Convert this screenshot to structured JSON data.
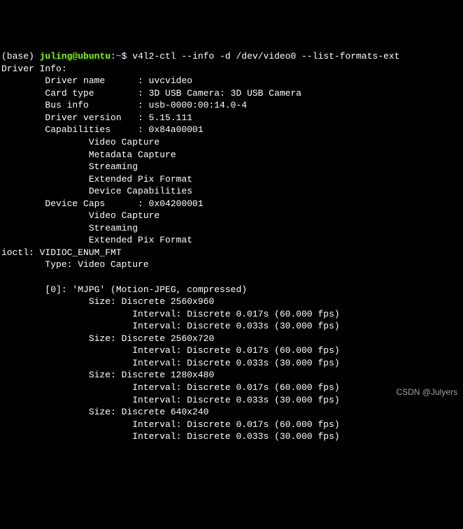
{
  "prompt": {
    "env": "(base) ",
    "user": "juling",
    "at": "@",
    "host": "ubuntu",
    "colon": ":",
    "path": "~",
    "dollar": "$ "
  },
  "command": "v4l2-ctl --info -d /dev/video0 --list-formats-ext",
  "driver_info_header": "Driver Info:",
  "driver_info": {
    "driver_name_label": "        Driver name      : ",
    "driver_name_value": "uvcvideo",
    "card_type_label": "        Card type        : ",
    "card_type_value": "3D USB Camera: 3D USB Camera",
    "bus_info_label": "        Bus info         : ",
    "bus_info_value": "usb-0000:00:14.0-4",
    "driver_version_label": "        Driver version   : ",
    "driver_version_value": "5.15.111",
    "capabilities_label": "        Capabilities     : ",
    "capabilities_value": "0x84a00001"
  },
  "caps": {
    "l0": "                Video Capture",
    "l1": "                Metadata Capture",
    "l2": "                Streaming",
    "l3": "                Extended Pix Format",
    "l4": "                Device Capabilities"
  },
  "device_caps_label": "        Device Caps      : ",
  "device_caps_value": "0x04200001",
  "dcaps": {
    "l0": "                Video Capture",
    "l1": "                Streaming",
    "l2": "                Extended Pix Format"
  },
  "ioctl_header": "ioctl: VIDIOC_ENUM_FMT",
  "ioctl_type": "        Type: Video Capture",
  "blank": "",
  "format_header": "        [0]: 'MJPG' (Motion-JPEG, compressed)",
  "sizes": {
    "s0": "                Size: Discrete 2560x960",
    "s0i0": "                        Interval: Discrete 0.017s (60.000 fps)",
    "s0i1": "                        Interval: Discrete 0.033s (30.000 fps)",
    "s1": "                Size: Discrete 2560x720",
    "s1i0": "                        Interval: Discrete 0.017s (60.000 fps)",
    "s1i1": "                        Interval: Discrete 0.033s (30.000 fps)",
    "s2": "                Size: Discrete 1280x480",
    "s2i0": "                        Interval: Discrete 0.017s (60.000 fps)",
    "s2i1": "                        Interval: Discrete 0.033s (30.000 fps)",
    "s3": "                Size: Discrete 640x240",
    "s3i0": "                        Interval: Discrete 0.017s (60.000 fps)",
    "s3i1": "                        Interval: Discrete 0.033s (30.000 fps)"
  },
  "watermark": "CSDN @Julyers"
}
